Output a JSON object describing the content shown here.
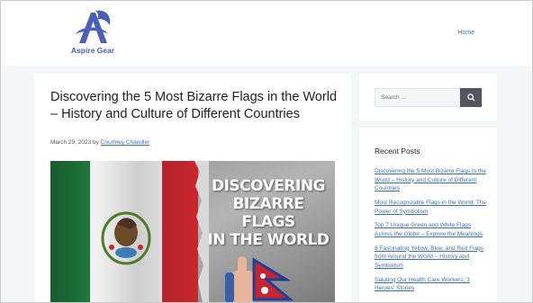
{
  "header": {
    "logo_text": "Aspire Gear",
    "nav": {
      "home": "Home"
    }
  },
  "article": {
    "title": "Discovering the 5 Most Bizarre Flags in the World – History and Culture of Different Countries",
    "date": "March 29, 2023",
    "by": "by",
    "author": "Courtney Chandler",
    "image": {
      "headline_lines": [
        "DISCOVERING",
        "BIZARRE FLAGS",
        "IN THE WORLD"
      ],
      "flag_colors": {
        "green": "#1f7a3d",
        "white": "#f2f2f2",
        "red": "#c8262f"
      }
    }
  },
  "sidebar": {
    "search": {
      "placeholder": "Search ..."
    },
    "recent": {
      "title": "Recent Posts",
      "posts": [
        "Discovering the 5 Most Bizarre Flags in the World – History and Culture of Different Countries",
        "Most Recognizable Flags in the World: The Power of Symbolism",
        "Top 7 Unique Green and White Flags Across the Globe – Explore the Meanings",
        "8 Fascinating Yellow, Blue, and Red Flags from Around the World – History and Symbolism",
        "Saluting Our Health Care Workers: 3 Heroes' Stories"
      ]
    }
  },
  "colors": {
    "link": "#3a6fb8",
    "brand": "#4a5fb6",
    "background": "#f4f5f6",
    "search_button": "#55555e"
  }
}
